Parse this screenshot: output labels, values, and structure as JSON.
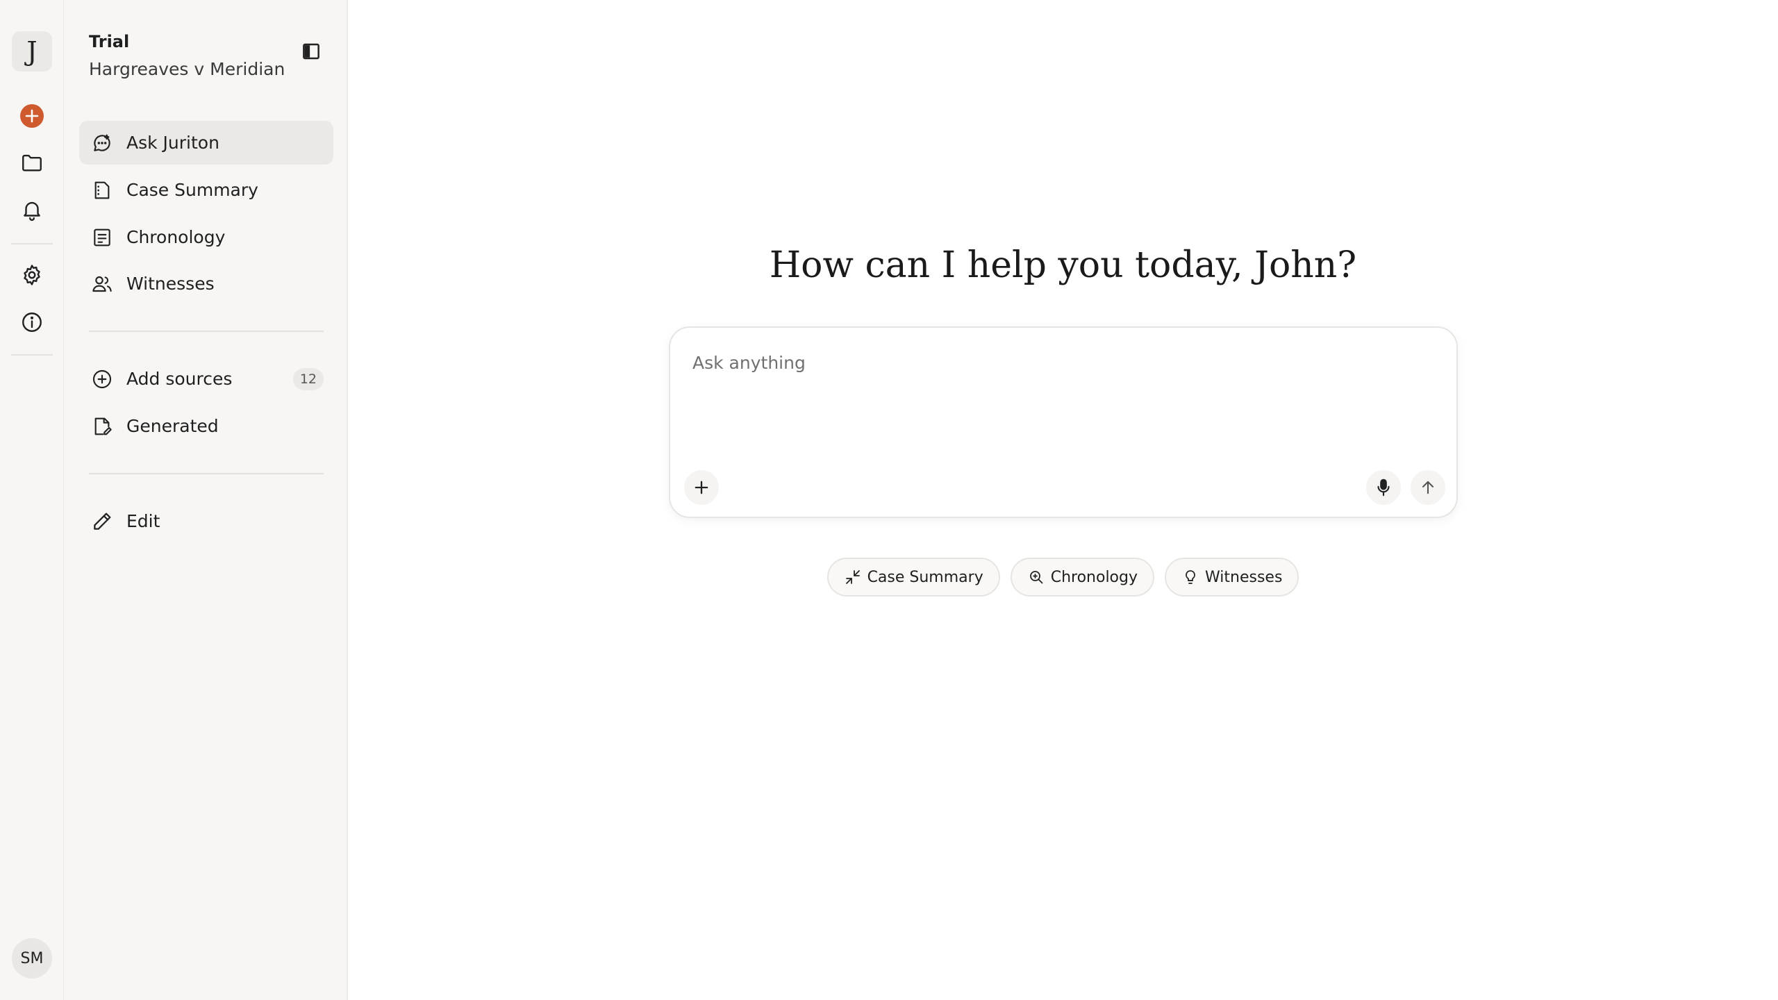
{
  "rail": {
    "logo_letter": "J",
    "avatar_initials": "SM",
    "accent_color": "#cf5a2e"
  },
  "project": {
    "label": "Trial",
    "name": "Hargreaves v Meridian"
  },
  "nav": {
    "items": [
      {
        "label": "Ask Juriton",
        "icon": "chat-icon",
        "active": true
      },
      {
        "label": "Case Summary",
        "icon": "document-icon"
      },
      {
        "label": "Chronology",
        "icon": "list-icon"
      },
      {
        "label": "Witnesses",
        "icon": "users-icon"
      }
    ],
    "sources": {
      "label": "Add sources",
      "count": "12",
      "icon": "plus-circle-icon"
    },
    "generated": {
      "label": "Generated",
      "icon": "file-edit-icon"
    },
    "edit": {
      "label": "Edit",
      "icon": "pencil-icon"
    }
  },
  "main": {
    "greeting": "How can I help you today, John?",
    "composer": {
      "placeholder": "Ask anything"
    },
    "chips": [
      {
        "label": "Case Summary",
        "icon": "compress-icon"
      },
      {
        "label": "Chronology",
        "icon": "search-zoom-icon"
      },
      {
        "label": "Witnesses",
        "icon": "lightbulb-icon"
      }
    ]
  }
}
